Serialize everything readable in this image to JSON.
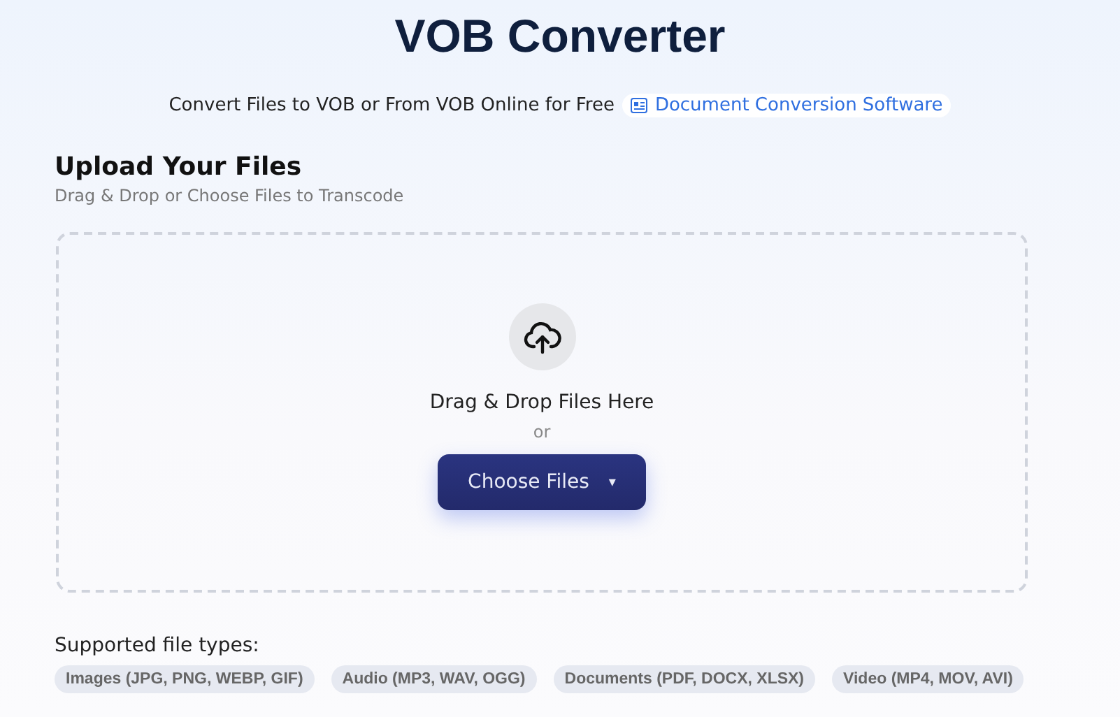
{
  "title": "VOB Converter",
  "subtitle": {
    "text": "Convert Files to VOB or From VOB Online for Free",
    "link": "Document Conversion Software"
  },
  "upload": {
    "heading": "Upload Your Files",
    "hint": "Drag & Drop or Choose Files to Transcode",
    "dropzone": {
      "prompt": "Drag & Drop Files Here",
      "or": "or",
      "button": {
        "label": "Choose Files",
        "caret": "▾"
      }
    }
  },
  "supported": {
    "label": "Supported file types:",
    "types": [
      "Images (JPG, PNG, WEBP, GIF)",
      "Audio (MP3, WAV, OGG)",
      "Documents (PDF, DOCX, XLSX)",
      "Video (MP4, MOV, AVI)"
    ]
  }
}
